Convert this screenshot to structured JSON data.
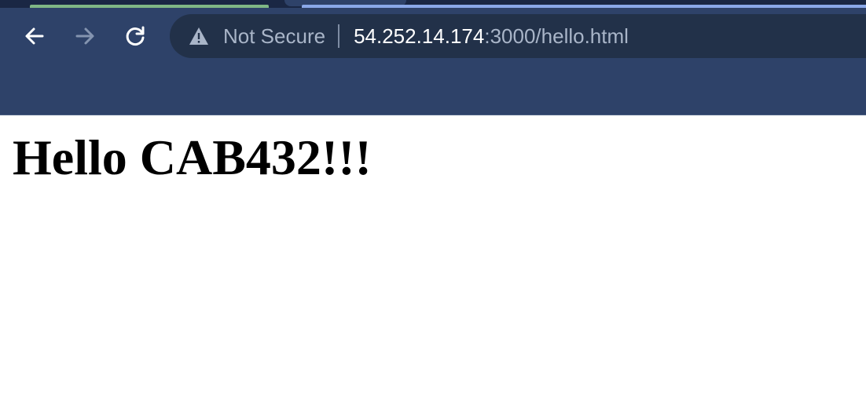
{
  "browser": {
    "security_label": "Not Secure",
    "url_host": "54.252.14.174",
    "url_rest": ":3000/hello.html",
    "icons": {
      "back": "back-arrow-icon",
      "forward": "forward-arrow-icon",
      "reload": "reload-icon",
      "security": "warning-triangle-icon"
    },
    "colors": {
      "toolbar": "#2e4269",
      "omnibox": "#223149",
      "tab_active_accent": "#7fb785",
      "tab_accent": "#8aa8e8"
    }
  },
  "page": {
    "heading": "Hello CAB432!!!"
  }
}
